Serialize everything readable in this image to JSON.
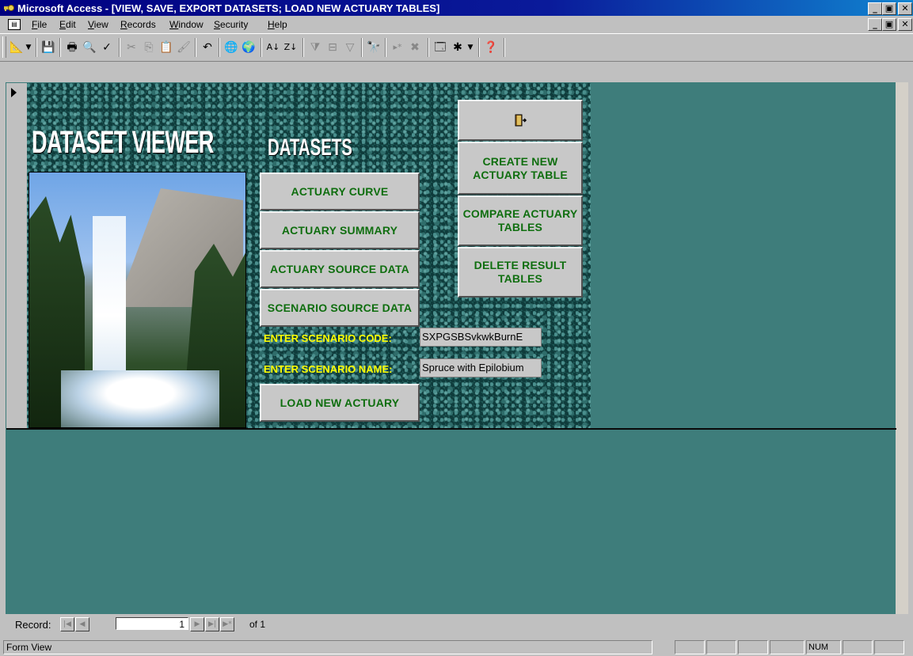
{
  "window": {
    "title": "Microsoft Access - [VIEW, SAVE, EXPORT DATASETS; LOAD NEW ACTUARY TABLES]",
    "buttons": {
      "minimize": "_",
      "restore": "▣",
      "close": "✕"
    },
    "doc_buttons": {
      "minimize": "_",
      "restore": "▣",
      "close": "✕"
    }
  },
  "menu": {
    "doc_icon": "form-icon",
    "items": [
      {
        "label": "File",
        "key": "F"
      },
      {
        "label": "Edit",
        "key": "E"
      },
      {
        "label": "View",
        "key": "V"
      },
      {
        "label": "Records",
        "key": "R"
      },
      {
        "label": "Window",
        "key": "W"
      },
      {
        "label": "Security",
        "key": "S"
      },
      {
        "label": "Help",
        "key": "H"
      }
    ]
  },
  "toolbar": {
    "icons": [
      "design-view-icon",
      "dropdown-arrow-icon",
      "save-icon",
      "print-icon",
      "print-preview-icon",
      "spelling-icon",
      "cut-icon",
      "copy-icon",
      "paste-icon",
      "format-painter-icon",
      "undo-icon",
      "insert-hyperlink-icon",
      "web-toolbar-icon",
      "sort-ascending-icon",
      "sort-descending-icon",
      "filter-by-selection-icon",
      "filter-by-form-icon",
      "apply-filter-icon",
      "find-icon",
      "new-record-icon",
      "delete-record-icon",
      "database-window-icon",
      "new-object-icon",
      "dropdown-arrow-icon",
      "help-icon"
    ]
  },
  "form": {
    "title_left": "DATASET VIEWER",
    "title_right": "DATASETS",
    "buttons": {
      "actuary_curve": "ACTUARY CURVE",
      "actuary_summary": "ACTUARY SUMMARY",
      "actuary_source_data": "ACTUARY SOURCE DATA",
      "scenario_source_data": "SCENARIO SOURCE DATA",
      "load_new_actuary": "LOAD NEW ACTUARY",
      "exit_icon": "exit-door-icon",
      "create_new_actuary_table": "CREATE NEW ACTUARY TABLE",
      "compare_actuary_tables": "COMPARE ACTUARY TABLES",
      "delete_result_tables": "DELETE RESULT TABLES"
    },
    "labels": {
      "scenario_code": "ENTER SCENARIO CODE:",
      "scenario_name": "ENTER SCENARIO NAME:"
    },
    "fields": {
      "scenario_code": "SXPGSBSvkwkBurnE",
      "scenario_name": "Spruce with Epilobium"
    }
  },
  "record_nav": {
    "label": "Record:",
    "current": "1",
    "of_text": "of 1"
  },
  "status": {
    "text": "Form View",
    "num": "NUM"
  }
}
